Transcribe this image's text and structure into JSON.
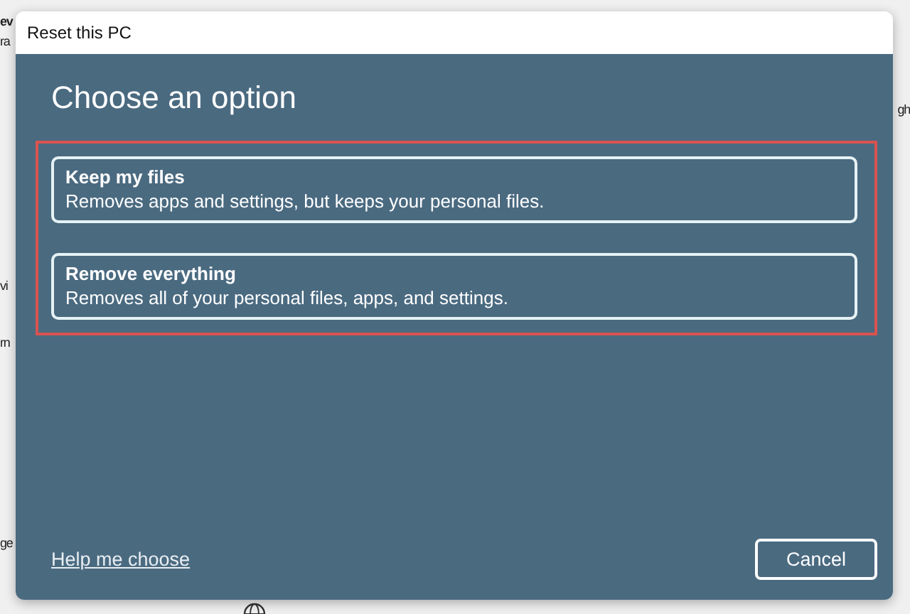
{
  "background": {
    "left_fragments": [
      {
        "text": "ev",
        "bold": true
      },
      {
        "text": "ra",
        "bold": false
      },
      {
        "text": "vi",
        "bold": false
      },
      {
        "text": "rn",
        "bold": false
      },
      {
        "text": "ge",
        "bold": false
      }
    ],
    "right_fragments": [
      {
        "text": "gh",
        "bold": false
      }
    ]
  },
  "dialog": {
    "title": "Reset this PC",
    "heading": "Choose an option",
    "options": [
      {
        "title": "Keep my files",
        "description": "Removes apps and settings, but keeps your personal files."
      },
      {
        "title": "Remove everything",
        "description": "Removes all of your personal files, apps, and settings."
      }
    ],
    "help_link": "Help me choose",
    "buttons": [
      "Cancel"
    ]
  }
}
